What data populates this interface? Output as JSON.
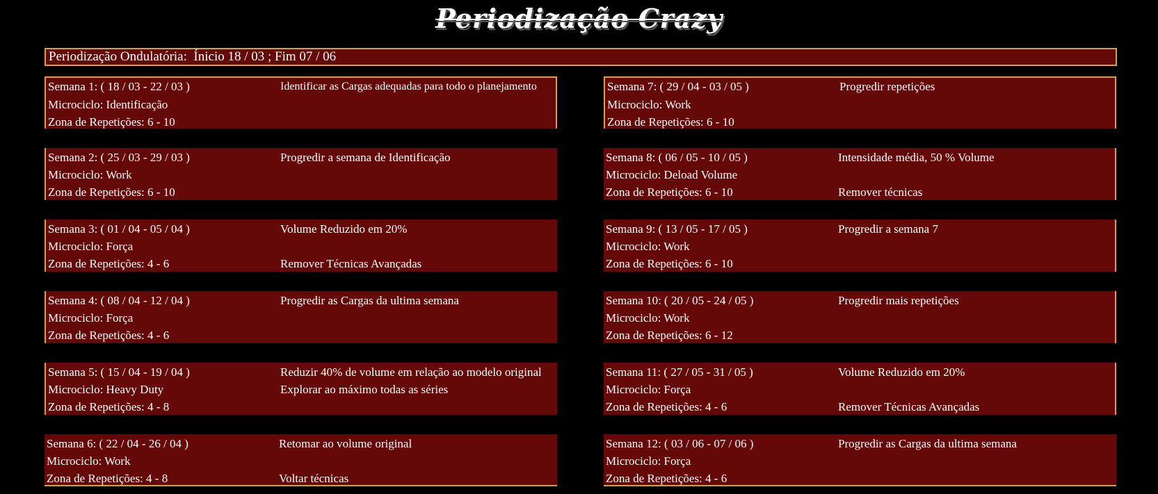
{
  "page_title": "Periodização Crazy",
  "summary": {
    "label": "Periodização Ondulatória:",
    "dates": "Ínicio 18 / 03 ; Fim 07 / 06"
  },
  "weeks": [
    {
      "title": "Semana 1: ( 18 / 03 - 22 / 03 )",
      "microciclo": "Microciclo: Identificação",
      "zona": "Zona de Repetições: 6 - 10",
      "note1": "Identificar as Cargas adequadas para todo o planejamento",
      "note2": "",
      "note3": ""
    },
    {
      "title": "Semana 2: ( 25 / 03 - 29 / 03 )",
      "microciclo": "Microciclo: Work",
      "zona": "Zona de Repetições: 6 - 10",
      "note1": "Progredir a semana de Identificação",
      "note2": "",
      "note3": ""
    },
    {
      "title": "Semana 3: ( 01 / 04 - 05 / 04 )",
      "microciclo": "Microciclo: Força",
      "zona": "Zona de Repetições: 4 - 6",
      "note1": "Volume Reduzido em 20%",
      "note2": "",
      "note3": "Remover Técnicas Avançadas"
    },
    {
      "title": "Semana 4: ( 08 / 04 - 12 / 04 )",
      "microciclo": "Microciclo: Força",
      "zona": "Zona de Repetições: 4 - 6",
      "note1": "Progredir as Cargas da ultima semana",
      "note2": "",
      "note3": ""
    },
    {
      "title": "Semana 5: ( 15 / 04 - 19 / 04 )",
      "microciclo": "Microciclo: Heavy Duty",
      "zona": "Zona de Repetições: 4 - 8",
      "note1": "Reduzir 40% de volume em relação ao modelo original",
      "note2": "Explorar ao máximo todas as séries",
      "note3": ""
    },
    {
      "title": "Semana 6: ( 22 / 04 - 26 / 04 )",
      "microciclo": "Microciclo: Work",
      "zona": "Zona de Repetições: 4 - 8",
      "note1": "Retomar ao volume original",
      "note2": "",
      "note3": "Voltar técnicas"
    },
    {
      "title": "Semana 7: ( 29 / 04 - 03 / 05 )",
      "microciclo": "Microciclo: Work",
      "zona": "Zona de Repetições: 6 - 10",
      "note1": "Progredir repetições",
      "note2": "",
      "note3": ""
    },
    {
      "title": "Semana 8: ( 06 / 05 - 10 / 05 )",
      "microciclo": "Microciclo: Deload Volume",
      "zona": "Zona de Repetições: 6 - 10",
      "note1": "Intensidade média, 50 % Volume",
      "note2": "",
      "note3": "Remover técnicas"
    },
    {
      "title": "Semana 9: ( 13 / 05 - 17 / 05 )",
      "microciclo": "Microciclo: Work",
      "zona": "Zona de Repetições: 6 - 10",
      "note1": "Progredir a semana 7",
      "note2": "",
      "note3": ""
    },
    {
      "title": "Semana 10: ( 20 / 05 - 24 / 05 )",
      "microciclo": "Microciclo: Work",
      "zona": "Zona de Repetições: 6 - 12",
      "note1": "Progredir mais repetições",
      "note2": "",
      "note3": ""
    },
    {
      "title": "Semana 11: ( 27 / 05 - 31 / 05 )",
      "microciclo": "Microciclo: Força",
      "zona": "Zona de Repetições: 4 - 6",
      "note1": "Volume Reduzido em 20%",
      "note2": "",
      "note3": "Remover Técnicas Avançadas"
    },
    {
      "title": "Semana 12: ( 03 / 06 - 07 / 06 )",
      "microciclo": "Microciclo: Força",
      "zona": "Zona de Repetições: 4 - 6",
      "note1": "Progredir as Cargas da ultima semana",
      "note2": "",
      "note3": ""
    }
  ]
}
